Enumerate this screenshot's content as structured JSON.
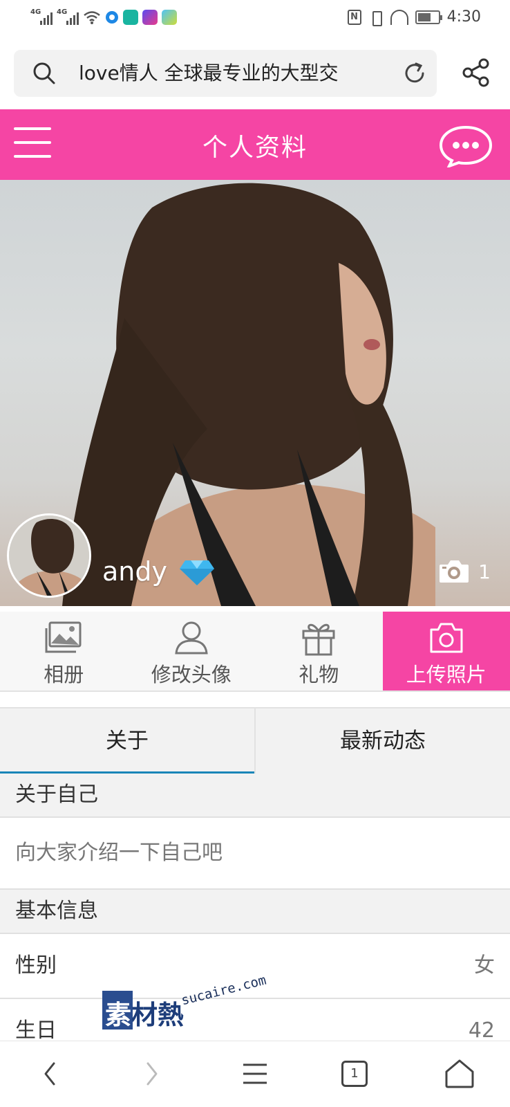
{
  "status_bar": {
    "sim1": "4G",
    "sim2": "4G",
    "nfc": "N",
    "time": "4:30",
    "battery_level": 0.65
  },
  "browser": {
    "url_text": "love情人 全球最专业的大型交"
  },
  "app": {
    "title": "个人资料",
    "accent_color": "#f545a4"
  },
  "profile": {
    "username": "andy",
    "photo_count": "1"
  },
  "actions": [
    {
      "label": "相册",
      "icon": "album-icon"
    },
    {
      "label": "修改头像",
      "icon": "user-icon"
    },
    {
      "label": "礼物",
      "icon": "gift-icon"
    },
    {
      "label": "上传照片",
      "icon": "camera-icon"
    }
  ],
  "tabs": [
    {
      "label": "关于",
      "active": true
    },
    {
      "label": "最新动态",
      "active": false
    }
  ],
  "about": {
    "section_title": "关于自己",
    "placeholder": "向大家介绍一下自己吧"
  },
  "basic_info": {
    "section_title": "基本信息",
    "gender_label": "性别",
    "gender_value": "女",
    "birthday_label": "生日",
    "birthday_value": "42"
  },
  "watermark": {
    "main": "素材熱",
    "first_char": "素",
    "rest": "材熱",
    "sub": "sucaire.com"
  },
  "bottom_nav": {
    "tab_count": "1"
  }
}
